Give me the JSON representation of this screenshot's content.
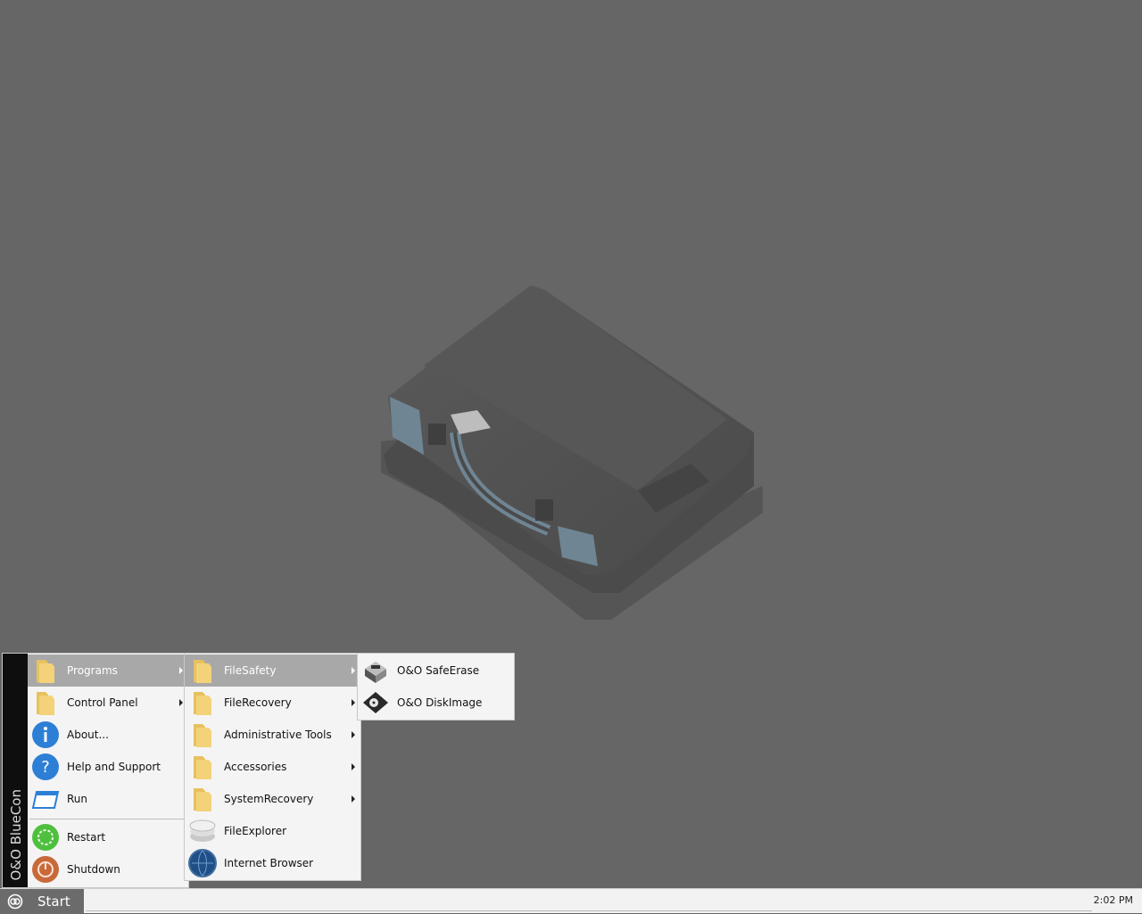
{
  "desktop": {
    "background_color": "#666666",
    "art_icon": "briefcase-wallpaper"
  },
  "start_menu": {
    "brand": "O&O BlueCon",
    "items": [
      {
        "label": "Programs",
        "icon": "folder-icon",
        "submenu": true,
        "highlighted": true
      },
      {
        "label": "Control Panel",
        "icon": "folder-icon",
        "submenu": true
      },
      {
        "label": "About...",
        "icon": "info-icon"
      },
      {
        "label": "Help and Support",
        "icon": "help-icon"
      },
      {
        "label": "Run",
        "icon": "run-window-icon"
      },
      {
        "label": "Restart",
        "icon": "restart-icon"
      },
      {
        "label": "Shutdown",
        "icon": "shutdown-icon"
      }
    ]
  },
  "programs_menu": {
    "items": [
      {
        "label": "FileSafety",
        "icon": "folder-icon",
        "submenu": true,
        "highlighted": true
      },
      {
        "label": "FileRecovery",
        "icon": "folder-icon",
        "submenu": true
      },
      {
        "label": "Administrative Tools",
        "icon": "folder-icon",
        "submenu": true
      },
      {
        "label": "Accessories",
        "icon": "folder-icon",
        "submenu": true
      },
      {
        "label": "SystemRecovery",
        "icon": "folder-icon",
        "submenu": true
      },
      {
        "label": "FileExplorer",
        "icon": "file-explorer-icon"
      },
      {
        "label": "Internet Browser",
        "icon": "globe-icon"
      }
    ]
  },
  "filesafety_menu": {
    "items": [
      {
        "label": "O&O SafeErase",
        "icon": "safeerase-icon"
      },
      {
        "label": "O&O DiskImage",
        "icon": "diskimage-icon"
      }
    ]
  },
  "taskbar": {
    "start_label": "Start",
    "clock": "2:02 PM"
  },
  "colors": {
    "highlight": "#a8a8a8",
    "folder": "#f3d27a",
    "info_blue": "#2d7fd6",
    "restart_green": "#4fbf3f",
    "shutdown_orange": "#c8693a"
  }
}
